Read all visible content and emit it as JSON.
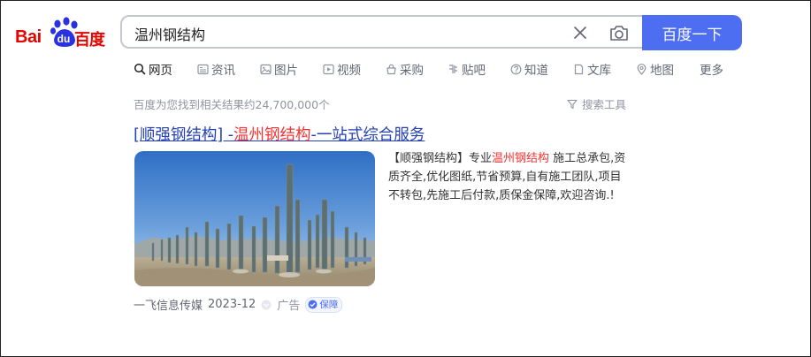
{
  "logo": {
    "left": "Bai",
    "badge": "du",
    "right": "百度"
  },
  "search": {
    "query": "温州钢结构",
    "submit_label": "百度一下"
  },
  "tabs": [
    {
      "label": "网页",
      "icon": "search-icon"
    },
    {
      "label": "资讯",
      "icon": "news-icon"
    },
    {
      "label": "图片",
      "icon": "image-icon"
    },
    {
      "label": "视频",
      "icon": "video-icon"
    },
    {
      "label": "采购",
      "icon": "purchase-icon"
    },
    {
      "label": "贴吧",
      "icon": "tieba-icon"
    },
    {
      "label": "知道",
      "icon": "question-icon"
    },
    {
      "label": "文库",
      "icon": "doc-icon"
    },
    {
      "label": "地图",
      "icon": "map-pin-icon"
    },
    {
      "label": "更多",
      "icon": ""
    }
  ],
  "results_count": "百度为您找到相关结果约24,700,000个",
  "search_tools": "搜索工具",
  "result": {
    "title_pre": "[顺强钢结构] -",
    "title_hl": "温州钢结构",
    "title_post": "-一站式综合服务",
    "desc_pre": "【顺强钢结构】专业",
    "desc_hl": "温州钢结构",
    "desc_post": " 施工总承包,资质齐全,优化图纸,节省预算,自有施工团队,项目不转包,先施工后付款,质保金保障,欢迎咨询.!",
    "source": "一飞信息传媒",
    "date": "2023-12",
    "ad_label": "广告",
    "guarantee_label": "保障"
  },
  "colors": {
    "brand": "#4e6ef2",
    "link": "#2440b3",
    "highlight": "#f73131",
    "logo_red": "#e10601"
  }
}
